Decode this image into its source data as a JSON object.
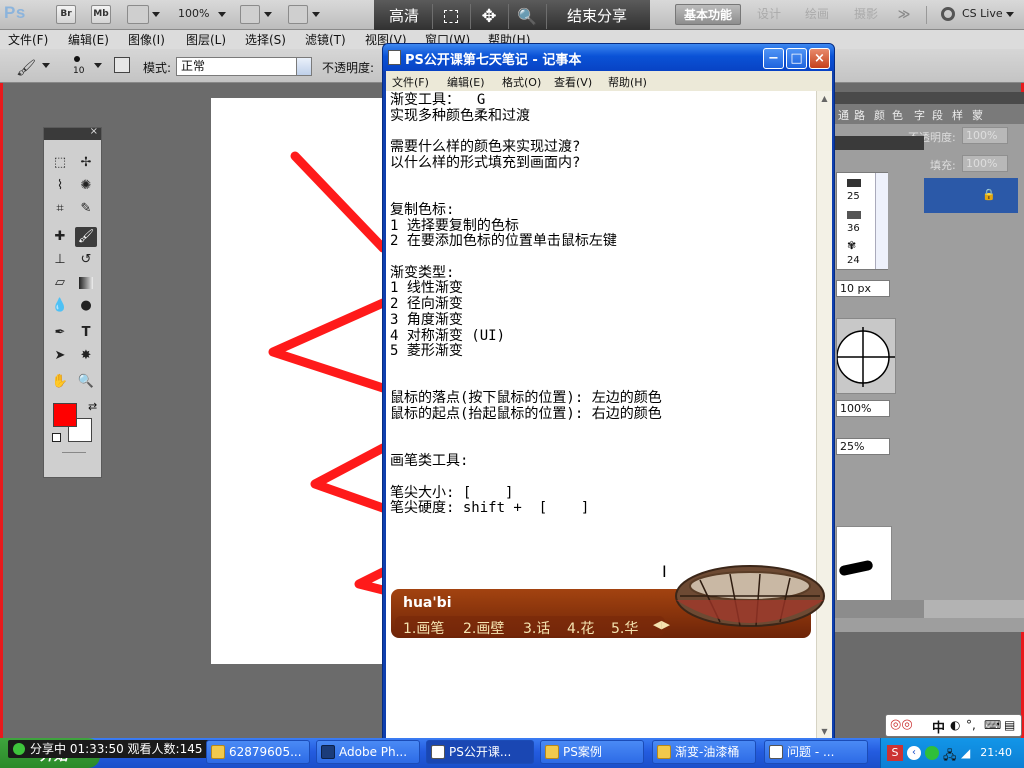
{
  "photoshop": {
    "logo": "Ps",
    "bridge_btn": "Br",
    "minibridge_btn": "Mb",
    "zoom": "100%",
    "workspaces": [
      "基本功能",
      "设计",
      "绘画",
      "摄影"
    ],
    "more_label": "≫",
    "cs_live": "CS Live",
    "menu": [
      "文件(F)",
      "编辑(E)",
      "图像(I)",
      "图层(L)",
      "选择(S)",
      "滤镜(T)",
      "视图(V)",
      "窗口(W)",
      "帮助(H)"
    ],
    "options": {
      "brush_size": "10",
      "mode_label": "模式:",
      "mode_value": "正常",
      "opacity_label": "不透明度:"
    },
    "panels": {
      "tabs": [
        "通",
        "路",
        "颜",
        "色",
        "字",
        "段",
        "样",
        "蒙"
      ],
      "opacity_label": "不透明度:",
      "opacity_value": "100%",
      "fill_label": "填充:",
      "fill_value": "100%",
      "brush_presets": [
        "25",
        "36",
        "24"
      ],
      "size_value": "10 px",
      "hardness_value": "100%",
      "spacing_value": "25%"
    }
  },
  "share_toolbar": {
    "quality": "高清",
    "end_share": "结束分享"
  },
  "notepad": {
    "title": "PS公开课第七天笔记 - 记事本",
    "menu": [
      "文件(F)",
      "编辑(E)",
      "格式(O)",
      "查看(V)",
      "帮助(H)"
    ],
    "lines": [
      "渐变工具：  G",
      "实现多种颜色柔和过渡",
      "",
      "需要什么样的颜色来实现过渡?",
      "以什么样的形式填充到画面内?",
      "",
      "",
      "复制色标:",
      "1 选择要复制的色标",
      "2 在要添加色标的位置单击鼠标左键",
      "",
      "渐变类型:",
      "1 线性渐变",
      "2 径向渐变",
      "3 角度渐变",
      "4 对称渐变 (UI)",
      "5 菱形渐变",
      "",
      "",
      "鼠标的落点(按下鼠标的位置): 左边的颜色",
      "鼠标的起点(抬起鼠标的位置): 右边的颜色",
      "",
      "",
      "画笔类工具:",
      "",
      "笔尖大小: [    ]",
      "笔尖硬度: shift +  [    ]"
    ]
  },
  "ime": {
    "input": "hua'bi",
    "candidates": [
      "1.画笔",
      "2.画壁",
      "3.话",
      "4.花",
      "5.华"
    ]
  },
  "taskbar": {
    "start_label": "开始",
    "live_status": "分享中 01:33:50 观看人数:145",
    "items": [
      "62879605...",
      "Adobe Ph...",
      "PS公开课...",
      "PS案例",
      "渐变-油漆桶",
      "问题 - ..."
    ],
    "tray_ime": "中",
    "clock": "21:40"
  },
  "colors": {
    "foreground": "#ff0000",
    "background": "#ffffff",
    "stroke_red": "#ff1a1a",
    "xp_blue": "#0a52d6"
  }
}
